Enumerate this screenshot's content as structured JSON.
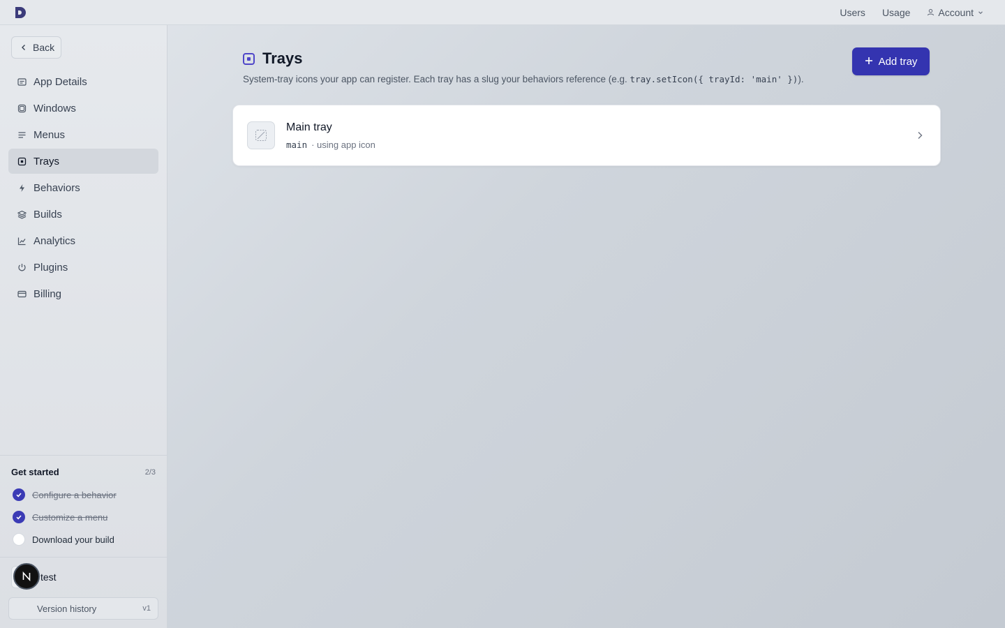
{
  "topbar": {
    "logo_icon": "app-logo-icon",
    "links": [
      "Users",
      "Usage"
    ],
    "account_label": "Account"
  },
  "sidebar": {
    "back_label": "Back",
    "items": [
      {
        "label": "App Details",
        "icon": "details-icon"
      },
      {
        "label": "Windows",
        "icon": "window-icon"
      },
      {
        "label": "Menus",
        "icon": "menu-icon"
      },
      {
        "label": "Trays",
        "icon": "tray-icon",
        "active": true
      },
      {
        "label": "Behaviors",
        "icon": "bolt-icon"
      },
      {
        "label": "Builds",
        "icon": "layers-icon"
      },
      {
        "label": "Analytics",
        "icon": "chart-icon"
      },
      {
        "label": "Plugins",
        "icon": "plug-icon"
      },
      {
        "label": "Billing",
        "icon": "card-icon"
      }
    ],
    "get_started": {
      "title": "Get started",
      "count": "2/3",
      "items": [
        {
          "label": "Configure a behavior",
          "done": true
        },
        {
          "label": "Customize a menu",
          "done": true
        },
        {
          "label": "Download your build",
          "done": false
        }
      ]
    },
    "app_name": "test",
    "version_label": "Version history",
    "version": "v1",
    "avatar_letter": "N"
  },
  "main": {
    "title": "Trays",
    "description_prefix": "System-tray icons your app can register. Each tray has a slug your behaviors reference (e.g. ",
    "description_code": "tray.setIcon({ trayId: 'main' })",
    "description_suffix": ").",
    "add_button": "Add tray",
    "trays": [
      {
        "name": "Main tray",
        "slug": "main",
        "meta": "· using app icon"
      }
    ]
  },
  "colors": {
    "accent": "#3434b0",
    "check": "#3b3bb5"
  }
}
